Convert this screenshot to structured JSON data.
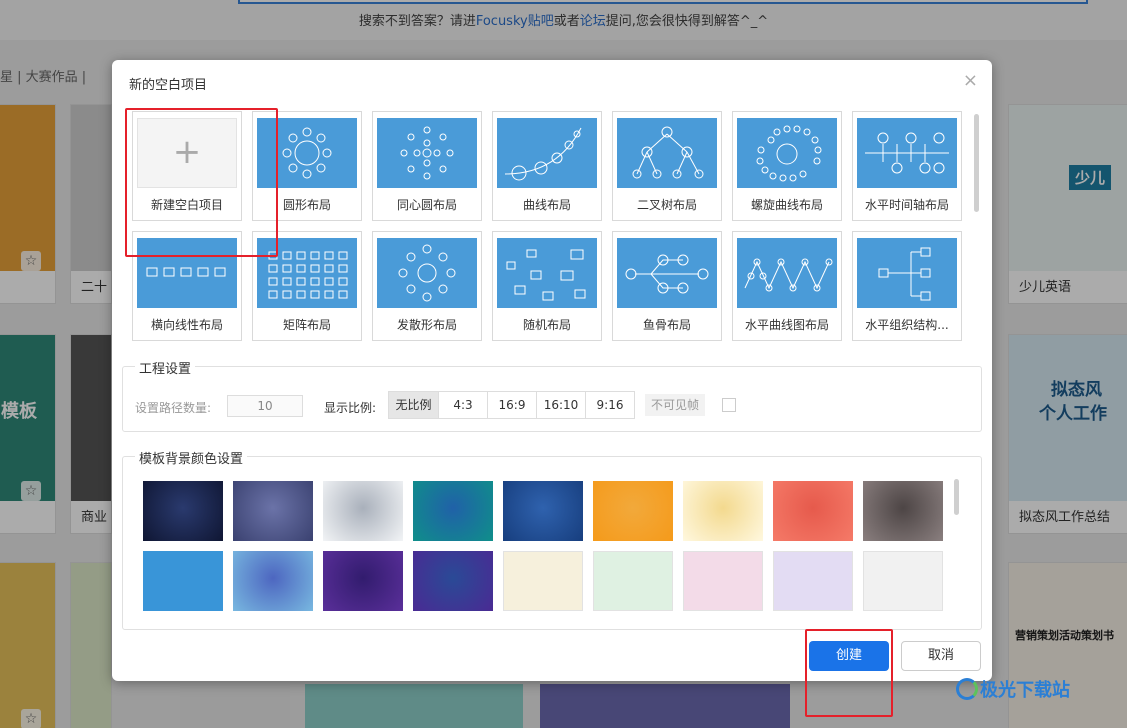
{
  "background": {
    "search_hint_pre": "搜索不到答案？请进",
    "search_hint_link1": "Focusky贴吧",
    "search_hint_mid": "或者",
    "search_hint_link2": "论坛",
    "search_hint_post": "提问,您会很快得到解答^_^",
    "nav": "星  |  大赛作品  |  ",
    "templates": [
      {
        "caption": "二十"
      },
      {
        "caption": "少儿英语"
      },
      {
        "caption": "商业"
      },
      {
        "caption": "拟态风工作总结"
      }
    ],
    "thumb_texts": {
      "kids_badge": "少儿",
      "mimic_title_1": "拟态风",
      "mimic_title_2": "个人工作",
      "template_word": "模板",
      "marketing": "营销策划活动策划书"
    }
  },
  "dialog": {
    "title": "新的空白项目",
    "close_icon": "close-icon",
    "layouts": [
      {
        "id": "blank",
        "label": "新建空白项目"
      },
      {
        "id": "circle",
        "label": "圆形布局"
      },
      {
        "id": "concentric",
        "label": "同心圆布局"
      },
      {
        "id": "curve",
        "label": "曲线布局"
      },
      {
        "id": "binary-tree",
        "label": "二叉树布局"
      },
      {
        "id": "spiral",
        "label": "螺旋曲线布局"
      },
      {
        "id": "h-timeline",
        "label": "水平时间轴布局"
      },
      {
        "id": "h-linear",
        "label": "横向线性布局"
      },
      {
        "id": "matrix",
        "label": "矩阵布局"
      },
      {
        "id": "radial",
        "label": "发散形布局"
      },
      {
        "id": "random",
        "label": "随机布局"
      },
      {
        "id": "fishbone",
        "label": "鱼骨布局"
      },
      {
        "id": "h-wave",
        "label": "水平曲线图布局"
      },
      {
        "id": "h-org",
        "label": "水平组织结构..."
      }
    ],
    "project_settings": {
      "legend": "工程设置",
      "path_count_label": "设置路径数量:",
      "path_count_value": "10",
      "ratio_label": "显示比例:",
      "ratios": [
        "无比例",
        "4:3",
        "16:9",
        "16:10",
        "9:16"
      ],
      "selected_ratio": "无比例",
      "invisible_frame_label": "不可见帧"
    },
    "bg_color_settings": {
      "legend": "模板背景颜色设置",
      "swatches_row1": [
        "#15224a",
        "#48507e",
        "#c9ced5",
        "#177fa0",
        "#1f4d92",
        "#f49e21",
        "#f8e9b8",
        "#ee6f5e",
        "#6e6363"
      ],
      "swatches_row2": [
        "#3995d8",
        "#5b86c8",
        "#4b2c8a",
        "#3d3290",
        "#f6f0dc",
        "#dff1e2",
        "#f3dbe8",
        "#e3dcf3",
        "#f1f1f1"
      ]
    },
    "create_label": "创建",
    "cancel_label": "取消"
  },
  "watermark": "极光下载站",
  "colors": {
    "accent": "#1a73e8",
    "highlight": "#e5202a",
    "layout_preview": "#4a9bd8"
  }
}
